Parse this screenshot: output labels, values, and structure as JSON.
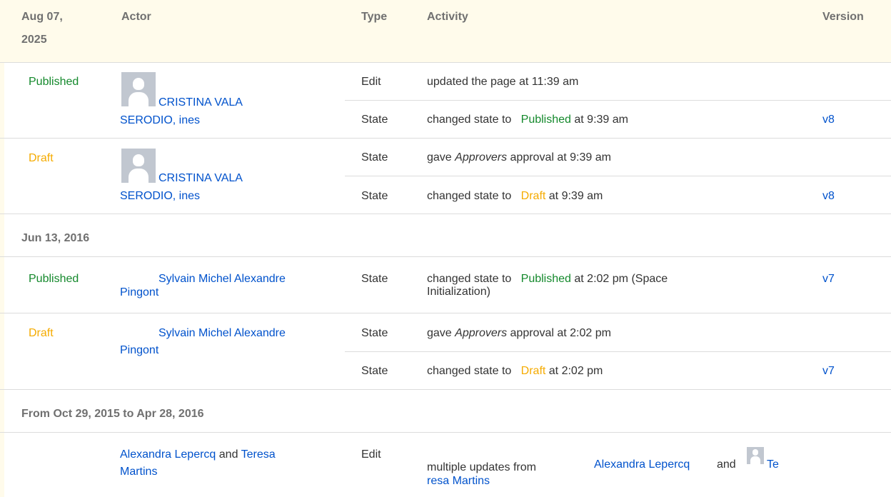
{
  "header": {
    "date_line1": "Aug 07,",
    "date_line2": "2025",
    "col_actor": "Actor",
    "col_type": "Type",
    "col_activity": "Activity",
    "col_version": "Version"
  },
  "groups": [
    {
      "entries": [
        {
          "status": "Published",
          "actor_line1": "CRISTINA VALA",
          "actor_line2": "SERODIO, ines",
          "rows": [
            {
              "type": "Edit",
              "activity": "updated the page at 11:39 am",
              "version": ""
            },
            {
              "type": "State",
              "prefix": "changed state to",
              "state": "Published",
              "suffix": "at 9:39 am",
              "version": "v8"
            }
          ]
        },
        {
          "status": "Draft",
          "actor_line1": "CRISTINA VALA",
          "actor_line2": "SERODIO, ines",
          "rows": [
            {
              "type": "State",
              "prefix": "gave",
              "italic": "Approvers",
              "suffix": "approval at 9:39 am",
              "version": ""
            },
            {
              "type": "State",
              "prefix": "changed state to",
              "state": "Draft",
              "suffix": "at 9:39 am",
              "version": "v8"
            }
          ]
        }
      ]
    },
    {
      "date": "Jun 13, 2016",
      "entries": [
        {
          "status": "Published",
          "actor_line1": "Sylvain Michel Alexandre",
          "actor_line2": "Pingont",
          "rows": [
            {
              "type": "State",
              "prefix": "changed state to",
              "state": "Published",
              "suffix": "at 2:02 pm (Space",
              "suffix_line2": "Initialization)",
              "version": "v7"
            }
          ]
        },
        {
          "status": "Draft",
          "actor_line1": "Sylvain Michel Alexandre",
          "actor_line2": "Pingont",
          "rows": [
            {
              "type": "State",
              "prefix": "gave",
              "italic": "Approvers",
              "suffix": "approval at 2:02 pm",
              "version": ""
            },
            {
              "type": "State",
              "prefix": "changed state to",
              "state": "Draft",
              "suffix": "at 2:02 pm",
              "version": "v7"
            }
          ]
        }
      ]
    },
    {
      "date": "From Oct 29, 2015 to Apr 28, 2016",
      "entries": [
        {
          "actor_a": "Alexandra Lepercq",
          "actor_and": "and",
          "actor_b_line1": "Teresa",
          "actor_b_line2": "Martins",
          "rows": [
            {
              "type": "Edit",
              "prefix": "multiple updates from",
              "link1": "Alexandra Lepercq",
              "and": "and",
              "link2_line1": "Te",
              "link2_line2": "resa Martins",
              "version": ""
            }
          ]
        }
      ]
    }
  ],
  "colors": {
    "header_bg": "#fffbeb",
    "published": "#14892c",
    "draft": "#f5ab00",
    "link": "#0052cc",
    "avatar_bg": "#c1c7d0"
  }
}
